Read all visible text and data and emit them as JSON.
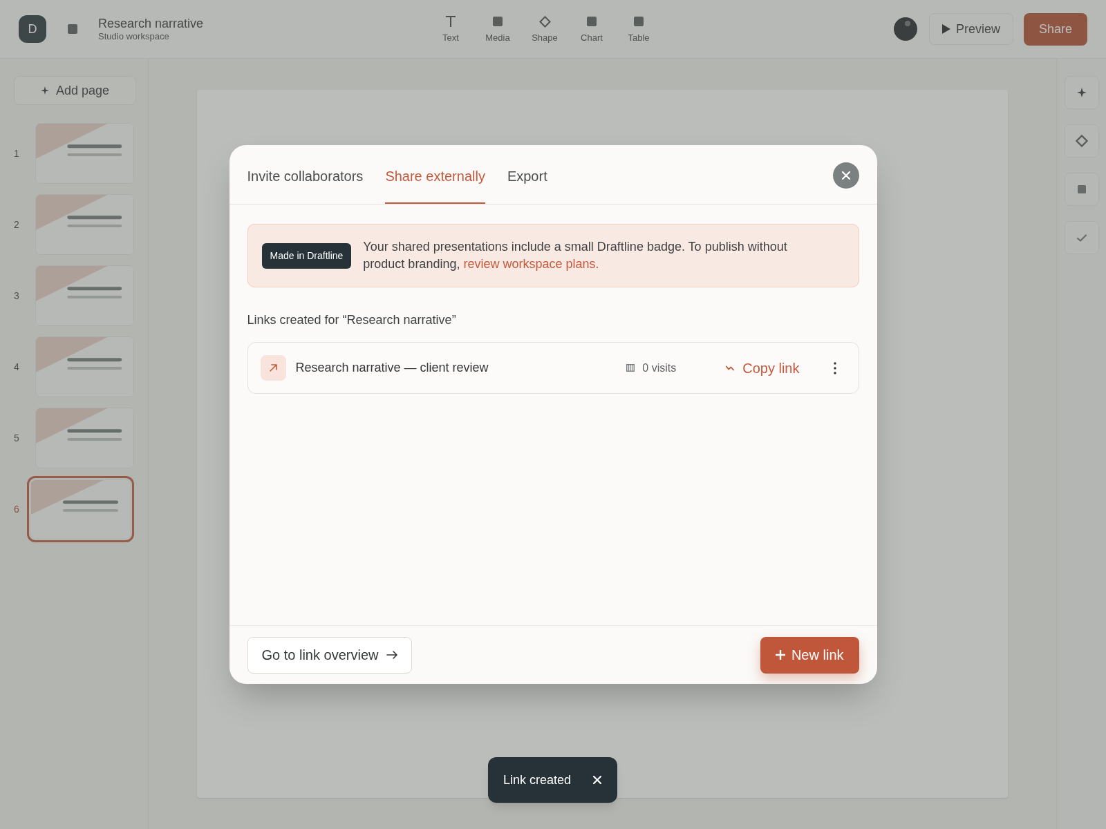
{
  "app": {
    "logo": "D",
    "title": "Research narrative",
    "subtitle": "Studio workspace",
    "tools": [
      {
        "kind": "text",
        "label": "Text"
      },
      {
        "kind": "media",
        "label": "Media"
      },
      {
        "kind": "shape",
        "label": "Shape"
      },
      {
        "kind": "chart",
        "label": "Chart"
      },
      {
        "kind": "table",
        "label": "Table"
      }
    ],
    "preview_button": "Preview",
    "share_button": "Share",
    "add_page_button": "Add page",
    "pages": [
      {
        "number": "1",
        "selected": false
      },
      {
        "number": "2",
        "selected": false
      },
      {
        "number": "3",
        "selected": false
      },
      {
        "number": "4",
        "selected": false
      },
      {
        "number": "5",
        "selected": false
      },
      {
        "number": "6",
        "selected": true
      }
    ],
    "rail_tools": [
      {
        "kind": "sparkle"
      },
      {
        "kind": "diamond"
      },
      {
        "kind": "square"
      },
      {
        "kind": "check"
      }
    ]
  },
  "dialog": {
    "tabs": [
      {
        "label": "Invite collaborators",
        "selected": false
      },
      {
        "label": "Share externally",
        "selected": true
      },
      {
        "label": "Export",
        "selected": false
      }
    ],
    "banner": {
      "badge": "Made in Draftline",
      "text": "Your shared presentations include a small Draftline badge. To publish without product branding,",
      "link": "review workspace plans."
    },
    "links_heading": "Links created for “Research narrative”",
    "links": [
      {
        "title": "Research narrative — client review",
        "visits": "0 visits",
        "copy_label": "Copy link"
      }
    ],
    "footer": {
      "overview_button": "Go to link overview",
      "new_link_button": "New link"
    }
  },
  "toast": {
    "message": "Link created"
  }
}
